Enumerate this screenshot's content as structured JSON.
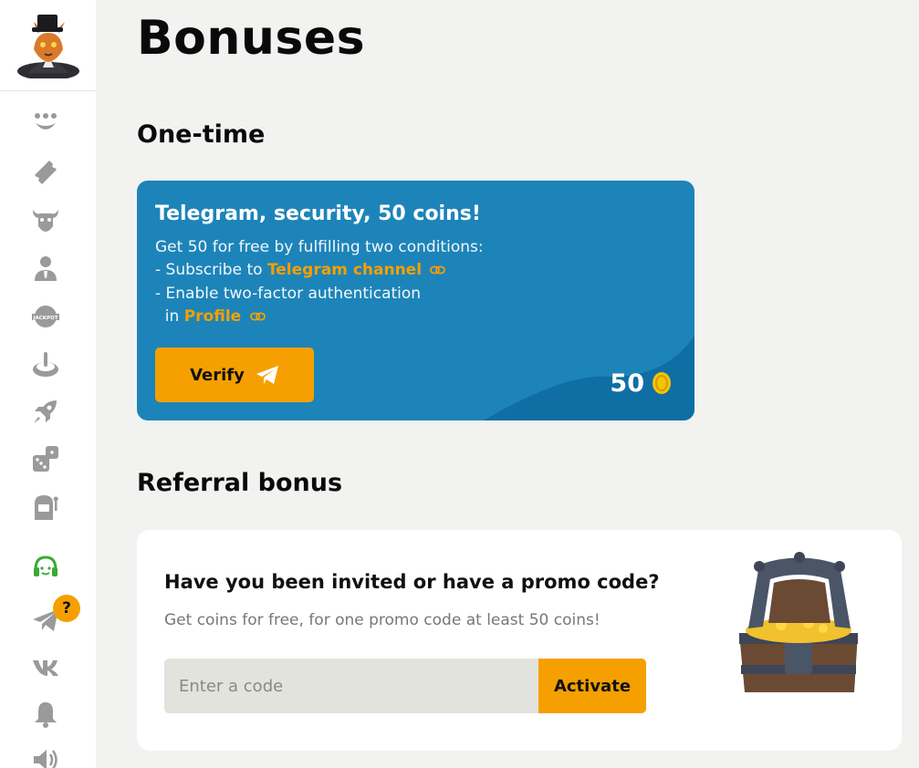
{
  "sidebar": {
    "logo": "fox-in-top-hat-logo",
    "items": [
      {
        "icon": "smile-icon"
      },
      {
        "icon": "ticket-icon"
      },
      {
        "icon": "bull-icon"
      },
      {
        "icon": "user-icon"
      },
      {
        "icon": "jackpot-icon",
        "text": "JACKPOT"
      },
      {
        "icon": "wheel-icon"
      },
      {
        "icon": "rocket-icon"
      },
      {
        "icon": "dice-icon"
      },
      {
        "icon": "slot-machine-icon"
      },
      {
        "icon": "support-headset-icon",
        "color": "#3aaa35"
      },
      {
        "icon": "telegram-icon",
        "badge": "?"
      },
      {
        "icon": "vk-icon"
      },
      {
        "icon": "bell-icon"
      },
      {
        "icon": "speaker-icon"
      }
    ]
  },
  "page": {
    "title": "Bonuses"
  },
  "one_time": {
    "section_title": "One-time",
    "card": {
      "title": "Telegram, security, 50 coins!",
      "line1": "Get 50 for free by fulfilling two conditions:",
      "line2_prefix": "- Subscribe to ",
      "line2_link": "Telegram channel",
      "line3": "- Enable two-factor authentication",
      "line4_prefix": "  in ",
      "line4_link": "Profile",
      "button_label": "Verify",
      "reward_amount": "50"
    }
  },
  "referral": {
    "section_title": "Referral bonus",
    "card": {
      "title": "Have you been invited or have a promo code?",
      "subtitle": "Get coins for free, for one promo code at least 50 coins!",
      "input_placeholder": "Enter a code",
      "input_value": "",
      "button_label": "Activate"
    }
  },
  "colors": {
    "accent": "#f5a000",
    "card_blue": "#1d84b9",
    "card_blue_dark": "#0f6fa4",
    "icon_gray": "#9a9a9a",
    "support_green": "#3aaa35"
  }
}
